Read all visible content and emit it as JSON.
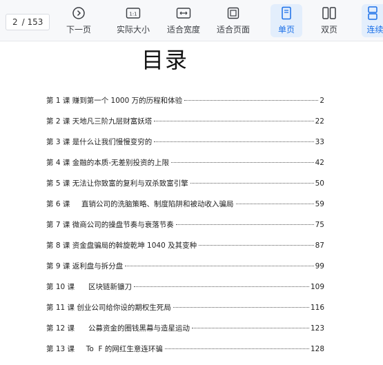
{
  "toolbar": {
    "page_current": "2",
    "page_total": "/ 153",
    "tools": [
      {
        "label": "下一页",
        "icon": "next-page-icon"
      },
      {
        "label": "实际大小",
        "icon": "actual-size-icon",
        "icon_text": "1:1"
      },
      {
        "label": "适合宽度",
        "icon": "fit-width-icon"
      },
      {
        "label": "适合页面",
        "icon": "fit-page-icon"
      },
      {
        "label": "单页",
        "icon": "single-page-icon"
      },
      {
        "label": "双页",
        "icon": "double-page-icon"
      },
      {
        "label": "连续",
        "icon": "continuous-icon"
      }
    ],
    "active_tool": "单页",
    "accent_color": "#1a6fe8"
  },
  "document": {
    "title": "目录",
    "toc": [
      {
        "title": "第 1 课 赚到第一个 1000 万的历程和体验",
        "page": "2"
      },
      {
        "title": "第 2 课 天地凡三阶九层财富妖塔",
        "page": "22"
      },
      {
        "title": "第 3 课 是什么让我们慢慢变穷的",
        "page": "33"
      },
      {
        "title": "第 4 课 金融的本质-无差别投资的上限",
        "page": "42"
      },
      {
        "title": "第 5 课  无法让你致富的复利与双杀致富引擎",
        "page": "50"
      },
      {
        "title": "第 6 课     直销公司的洗脑策略、制度陷阱和被动收入骗局",
        "page": "59"
      },
      {
        "title": "第 7 课 微商公司的操盘节奏与衰落节奏",
        "page": "75"
      },
      {
        "title": "第 8 课 资金盘骗局的斡旋乾坤 1040 及其变种",
        "page": "87"
      },
      {
        "title": "第 9 课 返利盘与拆分盘",
        "page": "99"
      },
      {
        "title": "第 10 课      区块链新镰刀",
        "page": "109"
      },
      {
        "title": "第 11 课 创业公司给你设的期权生死局",
        "page": "116"
      },
      {
        "title": "第 12 课      公募资金的圈钱黑幕与造星运动",
        "page": "123"
      },
      {
        "title": "第 13 课     To  F 的网红生意连环骗",
        "page": "128"
      }
    ]
  }
}
